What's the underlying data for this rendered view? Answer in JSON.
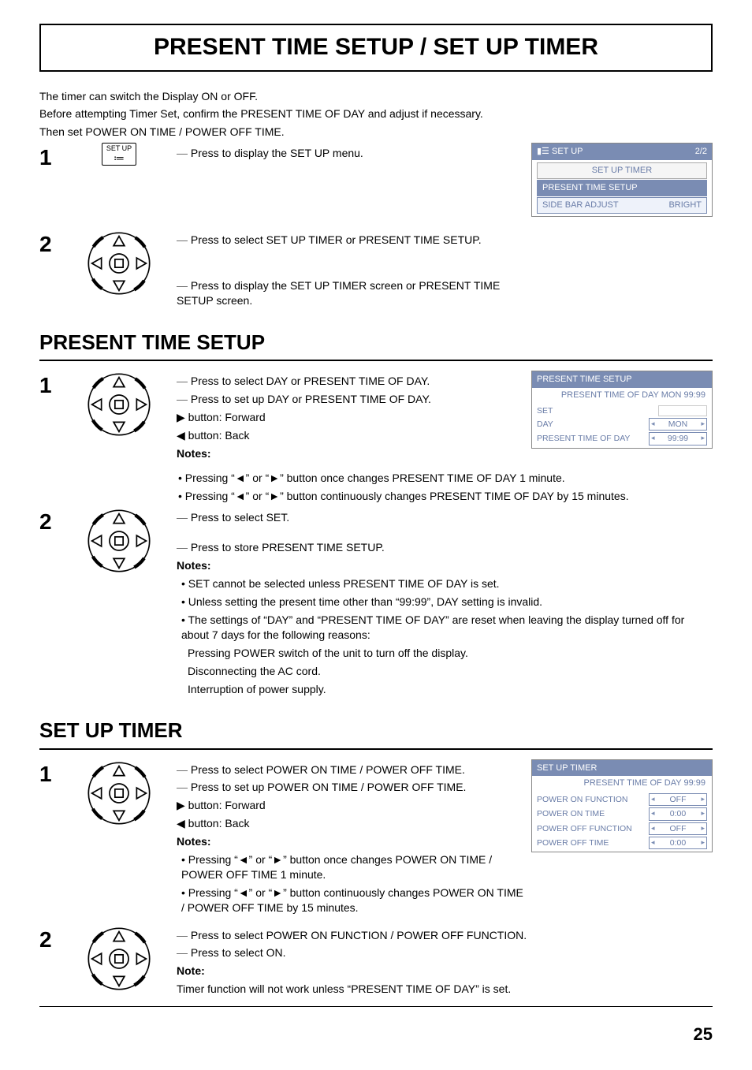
{
  "page_title": "PRESENT TIME SETUP / SET UP TIMER",
  "intro_line1": "The timer can switch the  Display ON or OFF.",
  "intro_line2": "Before attempting Timer Set, confirm the PRESENT TIME OF DAY and adjust if necessary.",
  "intro_line3": "Then set POWER ON TIME / POWER OFF TIME.",
  "setup_btn_label": "SET UP",
  "step1_text": "Press to display the SET UP menu.",
  "step2_line1": "Press to select SET UP TIMER or PRESENT TIME SETUP.",
  "step2_line2": "Press to display the SET UP TIMER screen or PRESENT TIME SETUP screen.",
  "osd_setup": {
    "header": "SET UP",
    "page": "2/2",
    "rows": [
      "SET UP TIMER",
      "PRESENT TIME SETUP"
    ],
    "bottom_label": "SIDE BAR ADJUST",
    "bottom_value": "BRIGHT"
  },
  "section_present": "PRESENT TIME SETUP",
  "p_step1_l1": "Press to select DAY or PRESENT TIME OF DAY.",
  "p_step1_l2": "Press to set up DAY or PRESENT TIME OF DAY.",
  "p_step1_fwd": "button: Forward",
  "p_step1_back": "button: Back",
  "notes_label": "Notes:",
  "p_note1": "Pressing “◄” or “►” button once changes PRESENT TIME OF DAY 1 minute.",
  "p_note2": "Pressing “◄” or “►” button continuously changes PRESENT TIME OF DAY by 15 minutes.",
  "osd_present": {
    "header": "PRESENT  TIME SETUP",
    "sub": "PRESENT  TIME OF DAY    MON  99:99",
    "row_set": "SET",
    "row_day_label": "DAY",
    "row_day_val": "MON",
    "row_ptod_label": "PRESENT  TIME OF DAY",
    "row_ptod_val": "99:99"
  },
  "p_step2_l1": "Press to select SET.",
  "p_step2_l2": "Press to store PRESENT TIME SETUP.",
  "p2_note1": "SET cannot be selected unless PRESENT TIME OF DAY is set.",
  "p2_note2": "Unless setting the present time other than “99:99”, DAY setting is invalid.",
  "p2_note3": "The settings of “DAY” and “PRESENT TIME OF DAY” are reset when leaving  the display turned off for about 7 days for the following reasons:",
  "p2_note3a": "Pressing POWER switch of the unit to turn off the display.",
  "p2_note3b": "Disconnecting the AC cord.",
  "p2_note3c": "Interruption of power supply.",
  "section_timer": "SET UP TIMER",
  "t_step1_l1": "Press to select POWER ON TIME / POWER OFF TIME.",
  "t_step1_l2": "Press to set up POWER ON TIME / POWER OFF TIME.",
  "t_step1_fwd": "button: Forward",
  "t_step1_back": "button: Back",
  "t_note1": "Pressing “◄” or “►” button once changes POWER ON TIME / POWER OFF TIME 1 minute.",
  "t_note2": "Pressing “◄” or “►” button continuously changes POWER ON TIME / POWER OFF TIME by 15 minutes.",
  "osd_timer": {
    "header": "SET UP TIMER",
    "sub": "PRESENT  TIME OF DAY    99:99",
    "rows": [
      {
        "label": "POWER ON FUNCTION",
        "val": "OFF"
      },
      {
        "label": "POWER ON TIME",
        "val": "0:00"
      },
      {
        "label": "POWER OFF FUNCTION",
        "val": "OFF"
      },
      {
        "label": "POWER OFF TIME",
        "val": "0:00"
      }
    ]
  },
  "t_step2_l1": "Press to select POWER ON FUNCTION / POWER OFF FUNCTION.",
  "t_step2_l2": "Press to select ON.",
  "note_label": "Note:",
  "t_final_note": "Timer function will not work unless “PRESENT TIME OF DAY” is set.",
  "page_number": "25"
}
